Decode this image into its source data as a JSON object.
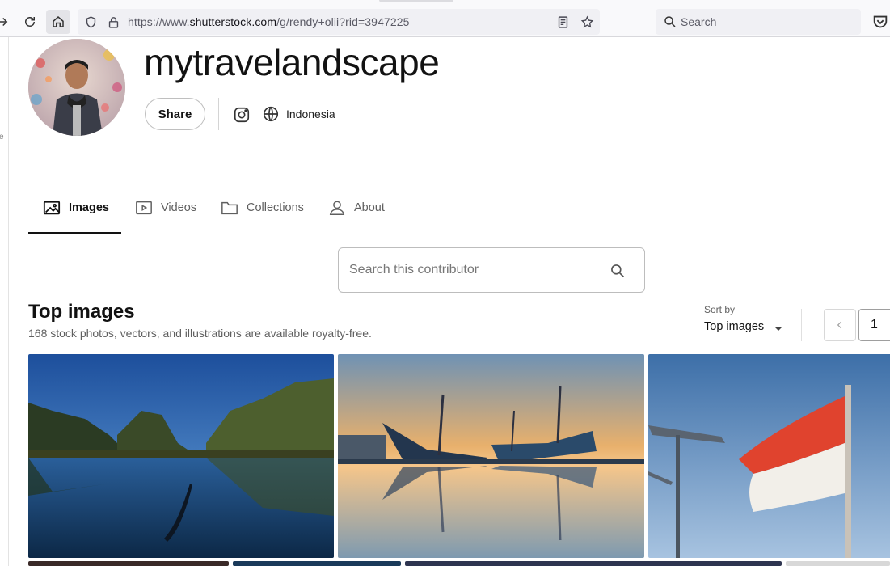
{
  "browser": {
    "url_prefix": "https://www.",
    "url_domain": "shutterstock.com",
    "url_path": "/g/rendy+olii?rid=3947225",
    "search_placeholder": "Search"
  },
  "profile": {
    "name": "mytravelandscape",
    "share_label": "Share",
    "location": "Indonesia"
  },
  "tabs": [
    {
      "label": "Images",
      "active": true
    },
    {
      "label": "Videos"
    },
    {
      "label": "Collections"
    },
    {
      "label": "About"
    }
  ],
  "contributor_search": {
    "placeholder": "Search this contributor"
  },
  "section": {
    "title": "Top images",
    "subtitle": "168 stock photos, vectors, and illustrations are available royalty-free."
  },
  "sort": {
    "label": "Sort by",
    "value": "Top images"
  },
  "pagination": {
    "page": "1"
  },
  "colors": {
    "accent": "#121212"
  },
  "icons": [
    "reload-icon",
    "home-icon",
    "shield-icon",
    "lock-icon",
    "reader-icon",
    "star-icon",
    "search-icon",
    "pocket-icon",
    "instagram-icon",
    "globe-icon",
    "image-icon",
    "video-icon",
    "folder-icon",
    "user-icon",
    "chevron-left-icon"
  ]
}
